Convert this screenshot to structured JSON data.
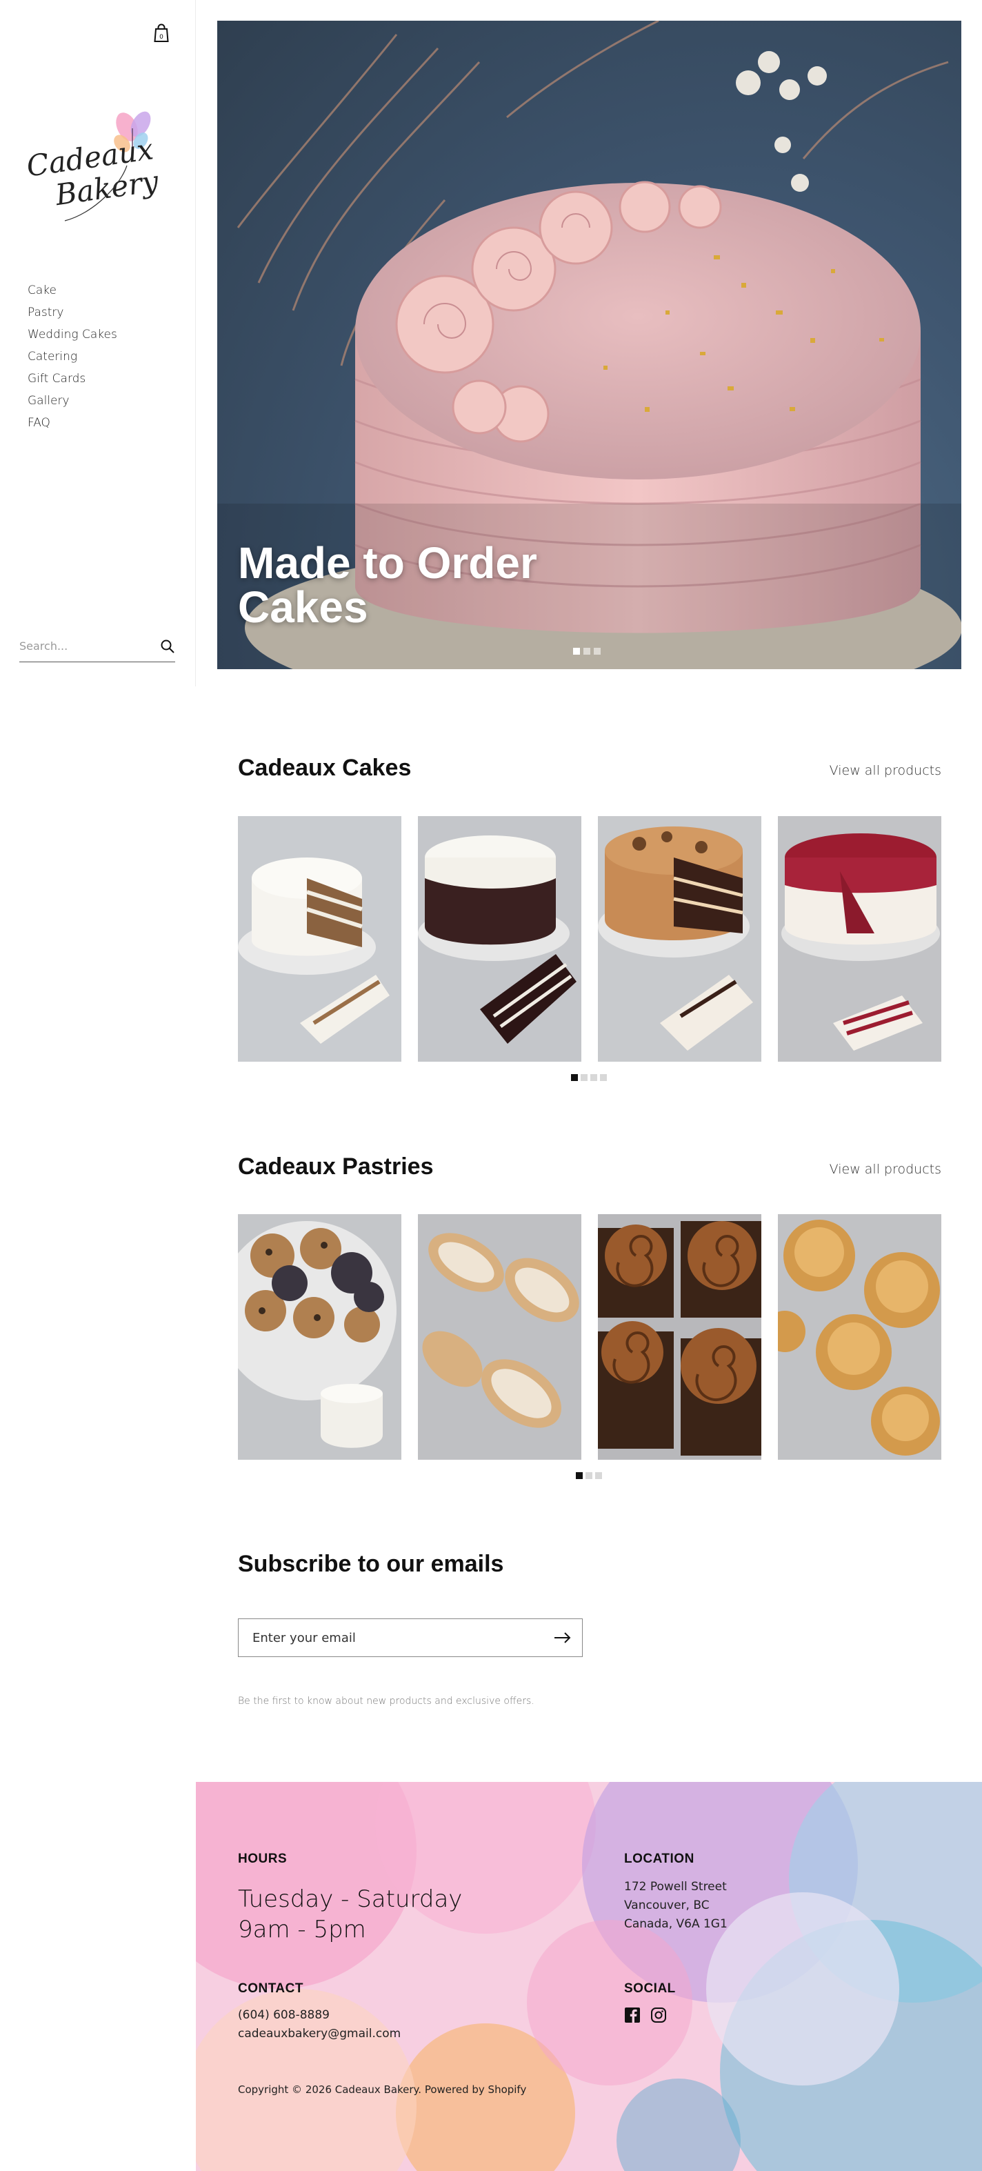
{
  "sidebar": {
    "logo_line1": "Cadeaux",
    "logo_line2": "Bakery",
    "nav": [
      {
        "label": "Cake"
      },
      {
        "label": "Pastry"
      },
      {
        "label": "Wedding Cakes"
      },
      {
        "label": "Catering"
      },
      {
        "label": "Gift Cards"
      },
      {
        "label": "Gallery"
      },
      {
        "label": "FAQ"
      }
    ],
    "cart_count": "0",
    "search_placeholder": "Search..."
  },
  "hero": {
    "title_line1": "Made to Order",
    "title_line2": "Cakes",
    "slides": 3,
    "active_slide": 1
  },
  "cakes": {
    "title": "Cadeaux Cakes",
    "view_all": "View all products",
    "items": [
      {
        "name": "vanilla-cake"
      },
      {
        "name": "chocolate-cake"
      },
      {
        "name": "caramel-cake"
      },
      {
        "name": "red-velvet-cake"
      }
    ],
    "pages": 4,
    "active_page": 1
  },
  "pastries": {
    "title": "Cadeaux Pastries",
    "view_all": "View all products",
    "items": [
      {
        "name": "cookies"
      },
      {
        "name": "almond-croissants"
      },
      {
        "name": "cinnamon-buns"
      },
      {
        "name": "scones"
      }
    ],
    "pages": 3,
    "active_page": 1
  },
  "subscribe": {
    "title": "Subscribe to our emails",
    "placeholder": "Enter your email",
    "note": "Be the first to know about new products and exclusive offers."
  },
  "footer": {
    "hours_heading": "HOURS",
    "hours_days": "Tuesday - Saturday",
    "hours_time": "9am - 5pm",
    "location_heading": "LOCATION",
    "address_1": "172 Powell Street",
    "address_2": "Vancouver, BC",
    "address_3": "Canada, V6A 1G1",
    "contact_heading": "CONTACT",
    "phone": "(604) 608-8889",
    "email": "cadeauxbakery@gmail.com",
    "social_heading": "SOCIAL",
    "social_icons": [
      "facebook-icon",
      "instagram-icon"
    ],
    "copyright": "Copyright © 2026 Cadeaux Bakery. Powered by Shopify"
  }
}
